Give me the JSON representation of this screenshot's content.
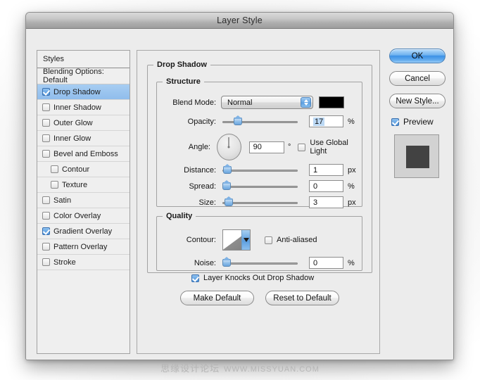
{
  "window": {
    "title": "Layer Style"
  },
  "styles_panel": {
    "header": "Styles",
    "blending_options": "Blending Options: Default",
    "items": [
      {
        "label": "Drop Shadow",
        "checked": true,
        "selected": true,
        "indent": false
      },
      {
        "label": "Inner Shadow",
        "checked": false,
        "selected": false,
        "indent": false
      },
      {
        "label": "Outer Glow",
        "checked": false,
        "selected": false,
        "indent": false
      },
      {
        "label": "Inner Glow",
        "checked": false,
        "selected": false,
        "indent": false
      },
      {
        "label": "Bevel and Emboss",
        "checked": false,
        "selected": false,
        "indent": false
      },
      {
        "label": "Contour",
        "checked": false,
        "selected": false,
        "indent": true
      },
      {
        "label": "Texture",
        "checked": false,
        "selected": false,
        "indent": true
      },
      {
        "label": "Satin",
        "checked": false,
        "selected": false,
        "indent": false
      },
      {
        "label": "Color Overlay",
        "checked": false,
        "selected": false,
        "indent": false
      },
      {
        "label": "Gradient Overlay",
        "checked": true,
        "selected": false,
        "indent": false
      },
      {
        "label": "Pattern Overlay",
        "checked": false,
        "selected": false,
        "indent": false
      },
      {
        "label": "Stroke",
        "checked": false,
        "selected": false,
        "indent": false
      }
    ]
  },
  "main": {
    "group_title": "Drop Shadow",
    "structure": {
      "title": "Structure",
      "blend_mode_label": "Blend Mode:",
      "blend_mode_value": "Normal",
      "shadow_color": "#000000",
      "opacity_label": "Opacity:",
      "opacity_value": "17",
      "opacity_unit": "%",
      "angle_label": "Angle:",
      "angle_value": "90",
      "angle_unit": "°",
      "use_global_light_label": "Use Global Light",
      "use_global_light_checked": false,
      "distance_label": "Distance:",
      "distance_value": "1",
      "distance_unit": "px",
      "spread_label": "Spread:",
      "spread_value": "0",
      "spread_unit": "%",
      "size_label": "Size:",
      "size_value": "3",
      "size_unit": "px"
    },
    "quality": {
      "title": "Quality",
      "contour_label": "Contour:",
      "anti_aliased_label": "Anti-aliased",
      "anti_aliased_checked": false,
      "noise_label": "Noise:",
      "noise_value": "0",
      "noise_unit": "%"
    },
    "knockout_label": "Layer Knocks Out Drop Shadow",
    "knockout_checked": true,
    "make_default_label": "Make Default",
    "reset_default_label": "Reset to Default"
  },
  "side": {
    "ok_label": "OK",
    "cancel_label": "Cancel",
    "new_style_label": "New Style...",
    "preview_label": "Preview",
    "preview_checked": true
  },
  "watermark": {
    "cn": "思缘设计论坛",
    "en": "WWW.MISSYUAN.COM"
  }
}
